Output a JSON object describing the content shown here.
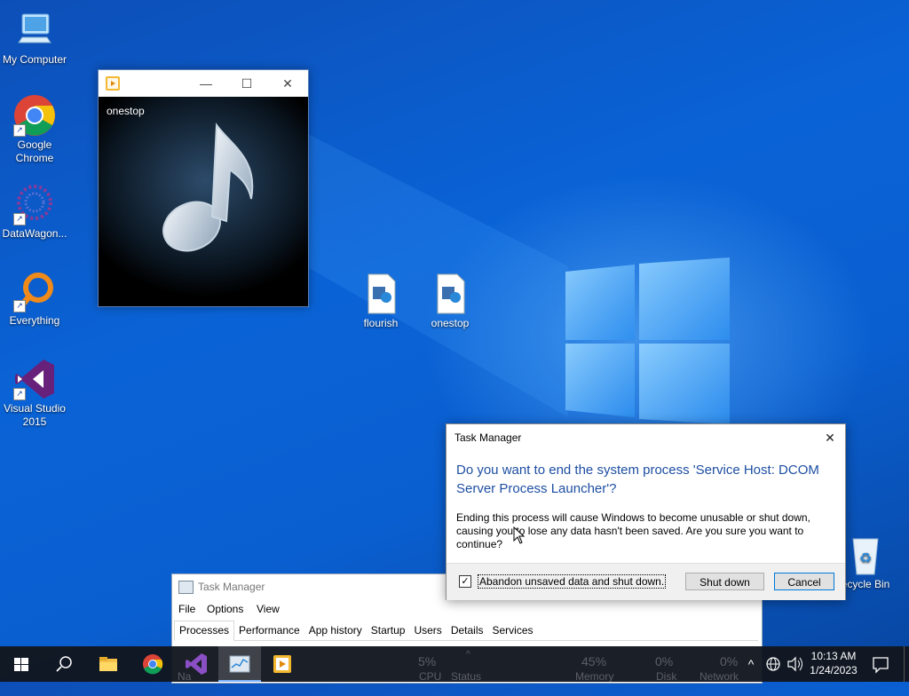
{
  "desktop": {
    "icons": [
      {
        "label": "My Computer"
      },
      {
        "label": "Google Chrome"
      },
      {
        "label": "DataWagon..."
      },
      {
        "label": "Everything"
      },
      {
        "label": "Visual Studio 2015"
      },
      {
        "label": "flourish"
      },
      {
        "label": "onestop"
      },
      {
        "label": "ecycle Bin"
      }
    ]
  },
  "media_window": {
    "title": "onestop",
    "app_icon": "media-player-icon",
    "minimize_glyph": "—",
    "maximize_glyph": "☐",
    "close_glyph": "✕"
  },
  "task_manager": {
    "title": "Task Manager",
    "menu": [
      "File",
      "Options",
      "View"
    ],
    "tabs": [
      "Processes",
      "Performance",
      "App history",
      "Startup",
      "Users",
      "Details",
      "Services"
    ],
    "active_tab": "Processes",
    "columns": [
      {
        "value": "5%",
        "label": "CPU"
      },
      {
        "value": "45%",
        "label": "Memory"
      },
      {
        "value": "0%",
        "label": "Disk"
      },
      {
        "value": "0%",
        "label": "Network"
      }
    ],
    "status_label": "Status",
    "name_label": "Na",
    "sort_glyph": "^"
  },
  "dialog": {
    "title": "Task Manager",
    "heading": "Do you want to end the system process 'Service Host: DCOM Server Process Launcher'?",
    "body": "Ending this process will cause Windows to become unusable or shut down, causing you to lose any data hasn't been saved. Are you sure you want to continue?",
    "checkbox_label": "Abandon unsaved data and shut down.",
    "checkbox_checked": true,
    "primary_button": "Shut down",
    "cancel_button": "Cancel",
    "close_glyph": "✕"
  },
  "taskbar": {
    "time": "10:13 AM",
    "date": "1/24/2023",
    "chevron_glyph": "^",
    "items": [
      "start-icon",
      "search-icon",
      "file-explorer-icon",
      "chrome-icon",
      "visual-studio-icon",
      "task-manager-icon",
      "media-player-icon"
    ]
  },
  "colors": {
    "desktop_blue": "#0a5fd0",
    "dialog_heading": "#1e4fa3",
    "taskbar": "#12161e"
  }
}
